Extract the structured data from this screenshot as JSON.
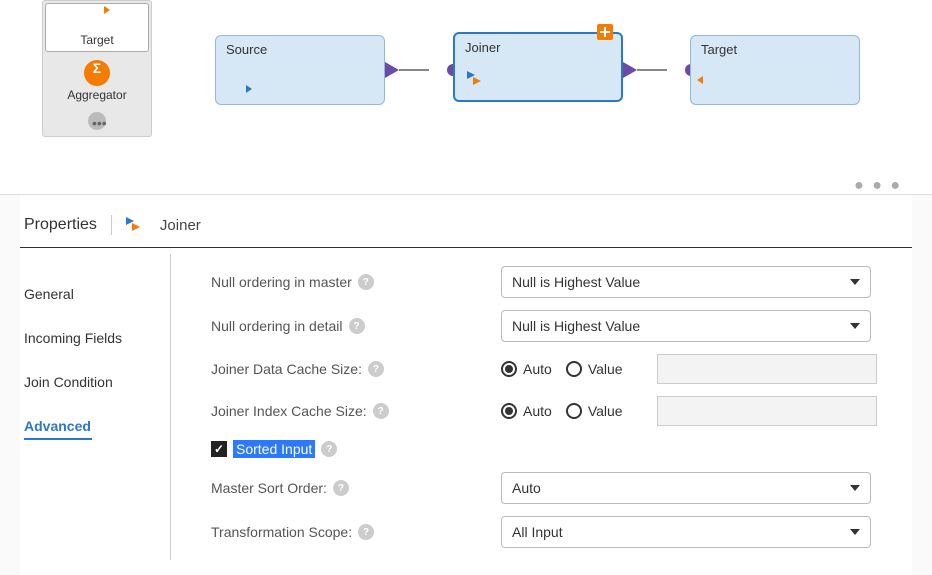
{
  "palette": {
    "target_label": "Target",
    "aggregator_label": "Aggregator"
  },
  "canvas": {
    "source_label": "Source",
    "joiner_label": "Joiner",
    "target_label": "Target"
  },
  "properties": {
    "heading": "Properties",
    "component_title": "Joiner",
    "tabs": {
      "general": "General",
      "incoming_fields": "Incoming Fields",
      "join_condition": "Join Condition",
      "advanced": "Advanced"
    },
    "form": {
      "null_master_label": "Null ordering in master",
      "null_master_value": "Null is Highest Value",
      "null_detail_label": "Null ordering in detail",
      "null_detail_value": "Null is Highest Value",
      "data_cache_label": "Joiner Data Cache Size:",
      "index_cache_label": "Joiner Index Cache Size:",
      "radio_auto": "Auto",
      "radio_value": "Value",
      "sorted_input_label": "Sorted Input",
      "master_sort_label": "Master Sort Order:",
      "master_sort_value": "Auto",
      "scope_label": "Transformation Scope:",
      "scope_value": "All Input"
    }
  }
}
